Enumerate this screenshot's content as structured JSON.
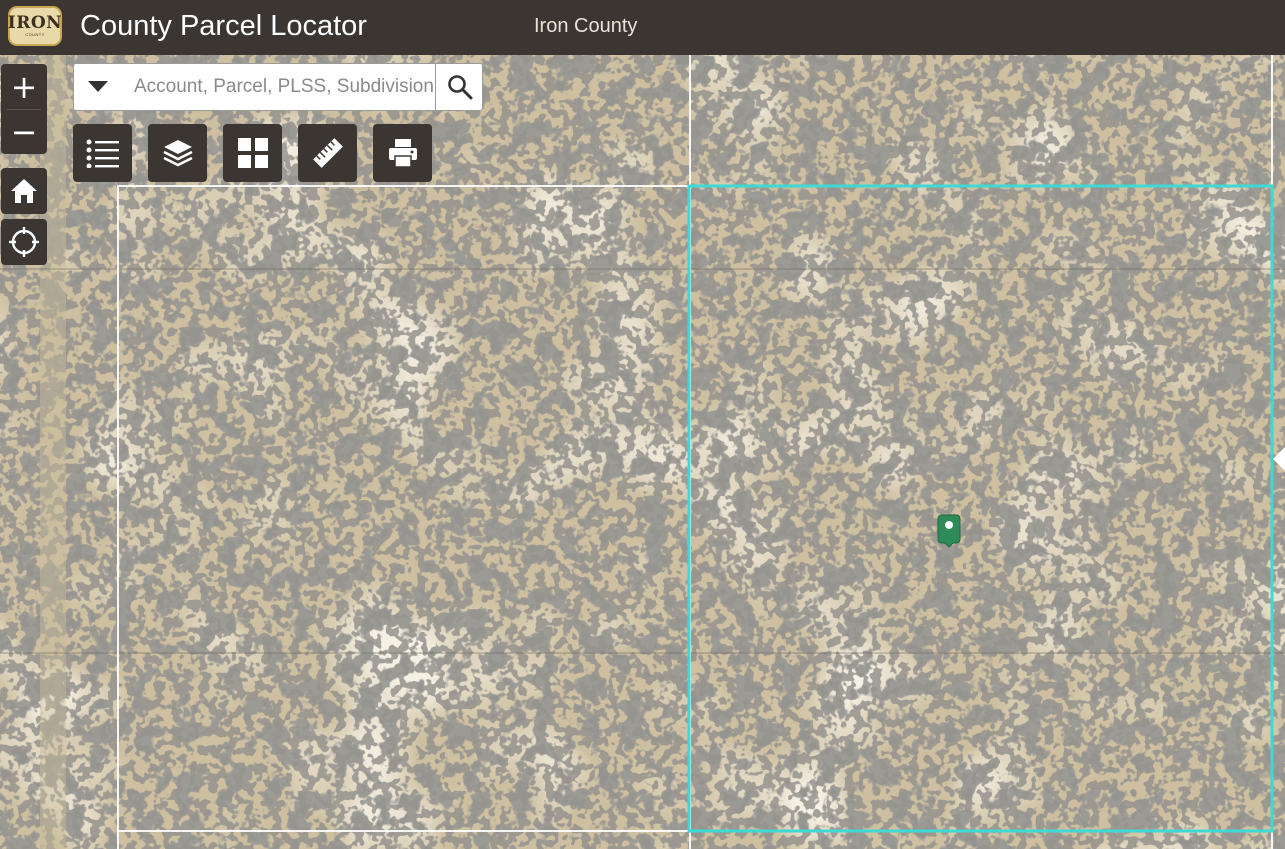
{
  "header": {
    "logo_text": "IRON",
    "logo_subtext": "COUNTY",
    "title": "County Parcel Locator",
    "county": "Iron County",
    "background": "#3b3631"
  },
  "search": {
    "placeholder": "Account, Parcel, PLSS, Subdivision",
    "value": ""
  },
  "zoom": {
    "in_label": "+",
    "out_label": "−"
  },
  "nav_icons": [
    "home-icon",
    "locate-icon"
  ],
  "toolbar": {
    "buttons": [
      "legend-list-icon",
      "layers-icon",
      "basemap-grid-icon",
      "measure-ruler-icon",
      "print-icon"
    ]
  },
  "map": {
    "basemap": "aerial imagery",
    "parcel_outline_color": "#ffffff",
    "selected_parcel_color": "#3fd9d5",
    "marker_color": "#2e8b57"
  }
}
